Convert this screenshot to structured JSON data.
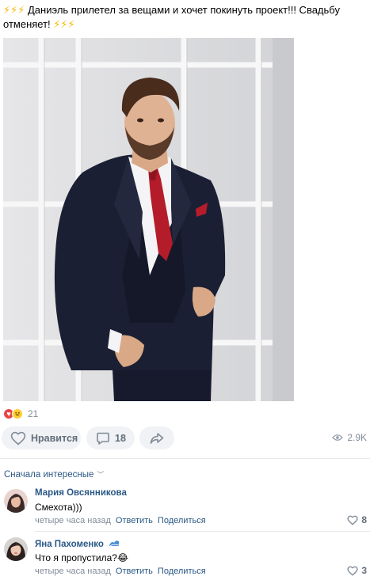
{
  "post": {
    "bolts_left": "⚡⚡⚡",
    "text": " Даниэль прилетел за вещами и хочет покинуть проект!!! Свадьбу отменяет! ",
    "bolts_right": "⚡⚡⚡"
  },
  "reactions": {
    "count": "21"
  },
  "actions": {
    "like_label": "Нравится",
    "comment_count": "18",
    "views": "2.9K"
  },
  "comments_header": {
    "sort_label": "Сначала интересные"
  },
  "comments": [
    {
      "author": "Мария Овсянникова",
      "text": "Смехота)))",
      "time": "четыре часа назад",
      "reply": "Ответить",
      "share": "Поделиться",
      "likes": "8"
    },
    {
      "author": "Яна Пахоменко",
      "text": "Что я пропустила?😂",
      "time": "четыре часа назад",
      "reply": "Ответить",
      "share": "Поделиться",
      "likes": "3"
    }
  ],
  "colors": {
    "link": "#2a5885",
    "muted": "#818c99",
    "pill_bg": "#f0f2f5",
    "heart": "#e64646"
  }
}
